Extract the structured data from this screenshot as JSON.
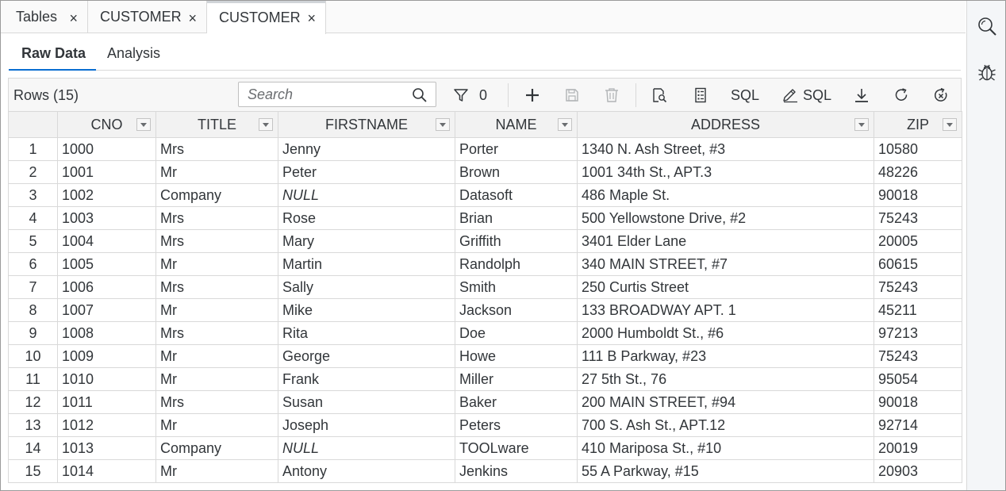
{
  "tabs": [
    {
      "label": "Tables",
      "close": "×"
    },
    {
      "label": "CUSTOMER",
      "close": "×"
    },
    {
      "label": "CUSTOMER",
      "close": "×"
    }
  ],
  "subtabs": [
    "Raw Data",
    "Analysis"
  ],
  "toolbar": {
    "rows_label": "Rows (15)",
    "search_placeholder": "Search",
    "filter_count": "0",
    "sql_label": "SQL",
    "edit_sql_label": "SQL"
  },
  "table": {
    "columns": [
      "CNO",
      "TITLE",
      "FIRSTNAME",
      "NAME",
      "ADDRESS",
      "ZIP"
    ],
    "rows": [
      [
        "1",
        "1000",
        "Mrs",
        "Jenny",
        "Porter",
        "1340 N. Ash Street, #3",
        "10580"
      ],
      [
        "2",
        "1001",
        "Mr",
        "Peter",
        "Brown",
        "1001 34th St., APT.3",
        "48226"
      ],
      [
        "3",
        "1002",
        "Company",
        "NULL",
        "Datasoft",
        "486 Maple St.",
        "90018"
      ],
      [
        "4",
        "1003",
        "Mrs",
        "Rose",
        "Brian",
        "500 Yellowstone Drive, #2",
        "75243"
      ],
      [
        "5",
        "1004",
        "Mrs",
        "Mary",
        "Griffith",
        "3401 Elder Lane",
        "20005"
      ],
      [
        "6",
        "1005",
        "Mr",
        "Martin",
        "Randolph",
        "340 MAIN STREET, #7",
        "60615"
      ],
      [
        "7",
        "1006",
        "Mrs",
        "Sally",
        "Smith",
        "250 Curtis Street",
        "75243"
      ],
      [
        "8",
        "1007",
        "Mr",
        "Mike",
        "Jackson",
        "133 BROADWAY APT. 1",
        "45211"
      ],
      [
        "9",
        "1008",
        "Mrs",
        "Rita",
        "Doe",
        "2000 Humboldt St., #6",
        "97213"
      ],
      [
        "10",
        "1009",
        "Mr",
        "George",
        "Howe",
        "111 B Parkway, #23",
        "75243"
      ],
      [
        "11",
        "1010",
        "Mr",
        "Frank",
        "Miller",
        "27 5th St., 76",
        "95054"
      ],
      [
        "12",
        "1011",
        "Mrs",
        "Susan",
        "Baker",
        "200 MAIN STREET, #94",
        "90018"
      ],
      [
        "13",
        "1012",
        "Mr",
        "Joseph",
        "Peters",
        "700 S. Ash St., APT.12",
        "92714"
      ],
      [
        "14",
        "1013",
        "Company",
        "NULL",
        "TOOLware",
        "410 Mariposa St., #10",
        "20019"
      ],
      [
        "15",
        "1014",
        "Mr",
        "Antony",
        "Jenkins",
        "55 A Parkway, #15",
        "20903"
      ]
    ]
  },
  "icons": {
    "right_sidebar": [
      "search-icon",
      "debug-icon"
    ],
    "toolbar": [
      "search-icon",
      "filter-icon",
      "add-icon",
      "save-icon",
      "delete-icon",
      "inspect-icon",
      "columns-icon",
      "edit-sql-icon",
      "download-icon",
      "refresh-icon",
      "clear-icon"
    ]
  },
  "colors": {
    "accent": "#0a6ed1"
  }
}
